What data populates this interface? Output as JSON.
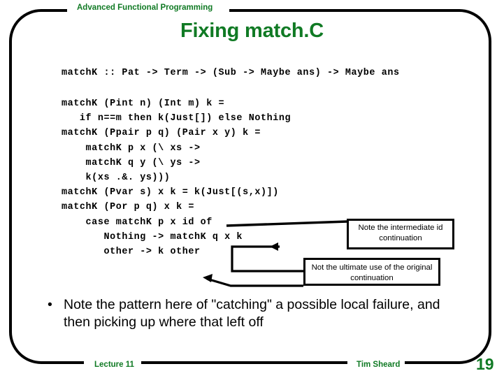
{
  "slide": {
    "header_label": "Advanced Functional Programming",
    "title": "Fixing match.C",
    "page_number": "19",
    "accent_color": "#107a24",
    "frame_color": "#000000"
  },
  "code": {
    "signature": "matchK :: Pat -> Term -> (Sub -> Maybe ans) -> Maybe ans",
    "body": "matchK (Pint n) (Int m) k =\n   if n==m then k(Just[]) else Nothing\nmatchK (Ppair p q) (Pair x y) k =\n    matchK p x (\\ xs ->\n    matchK q y (\\ ys ->\n    k(xs .&. ys)))\nmatchK (Pvar s) x k = k(Just[(s,x)])\nmatchK (Por p q) x k =\n    case matchK p x id of\n       Nothing -> matchK q x k\n       other -> k other"
  },
  "callouts": [
    {
      "id": "intermediate-id",
      "text": "Note the intermediate id continuation"
    },
    {
      "id": "original-continuation",
      "text": "Not the ultimate use of the original continuation"
    }
  ],
  "bullet": {
    "marker": "•",
    "text": "Note the pattern here of \"catching\" a possible local failure,  and then picking up where that left off"
  },
  "footer": {
    "lecture": "Lecture 11",
    "author": "Tim Sheard"
  }
}
